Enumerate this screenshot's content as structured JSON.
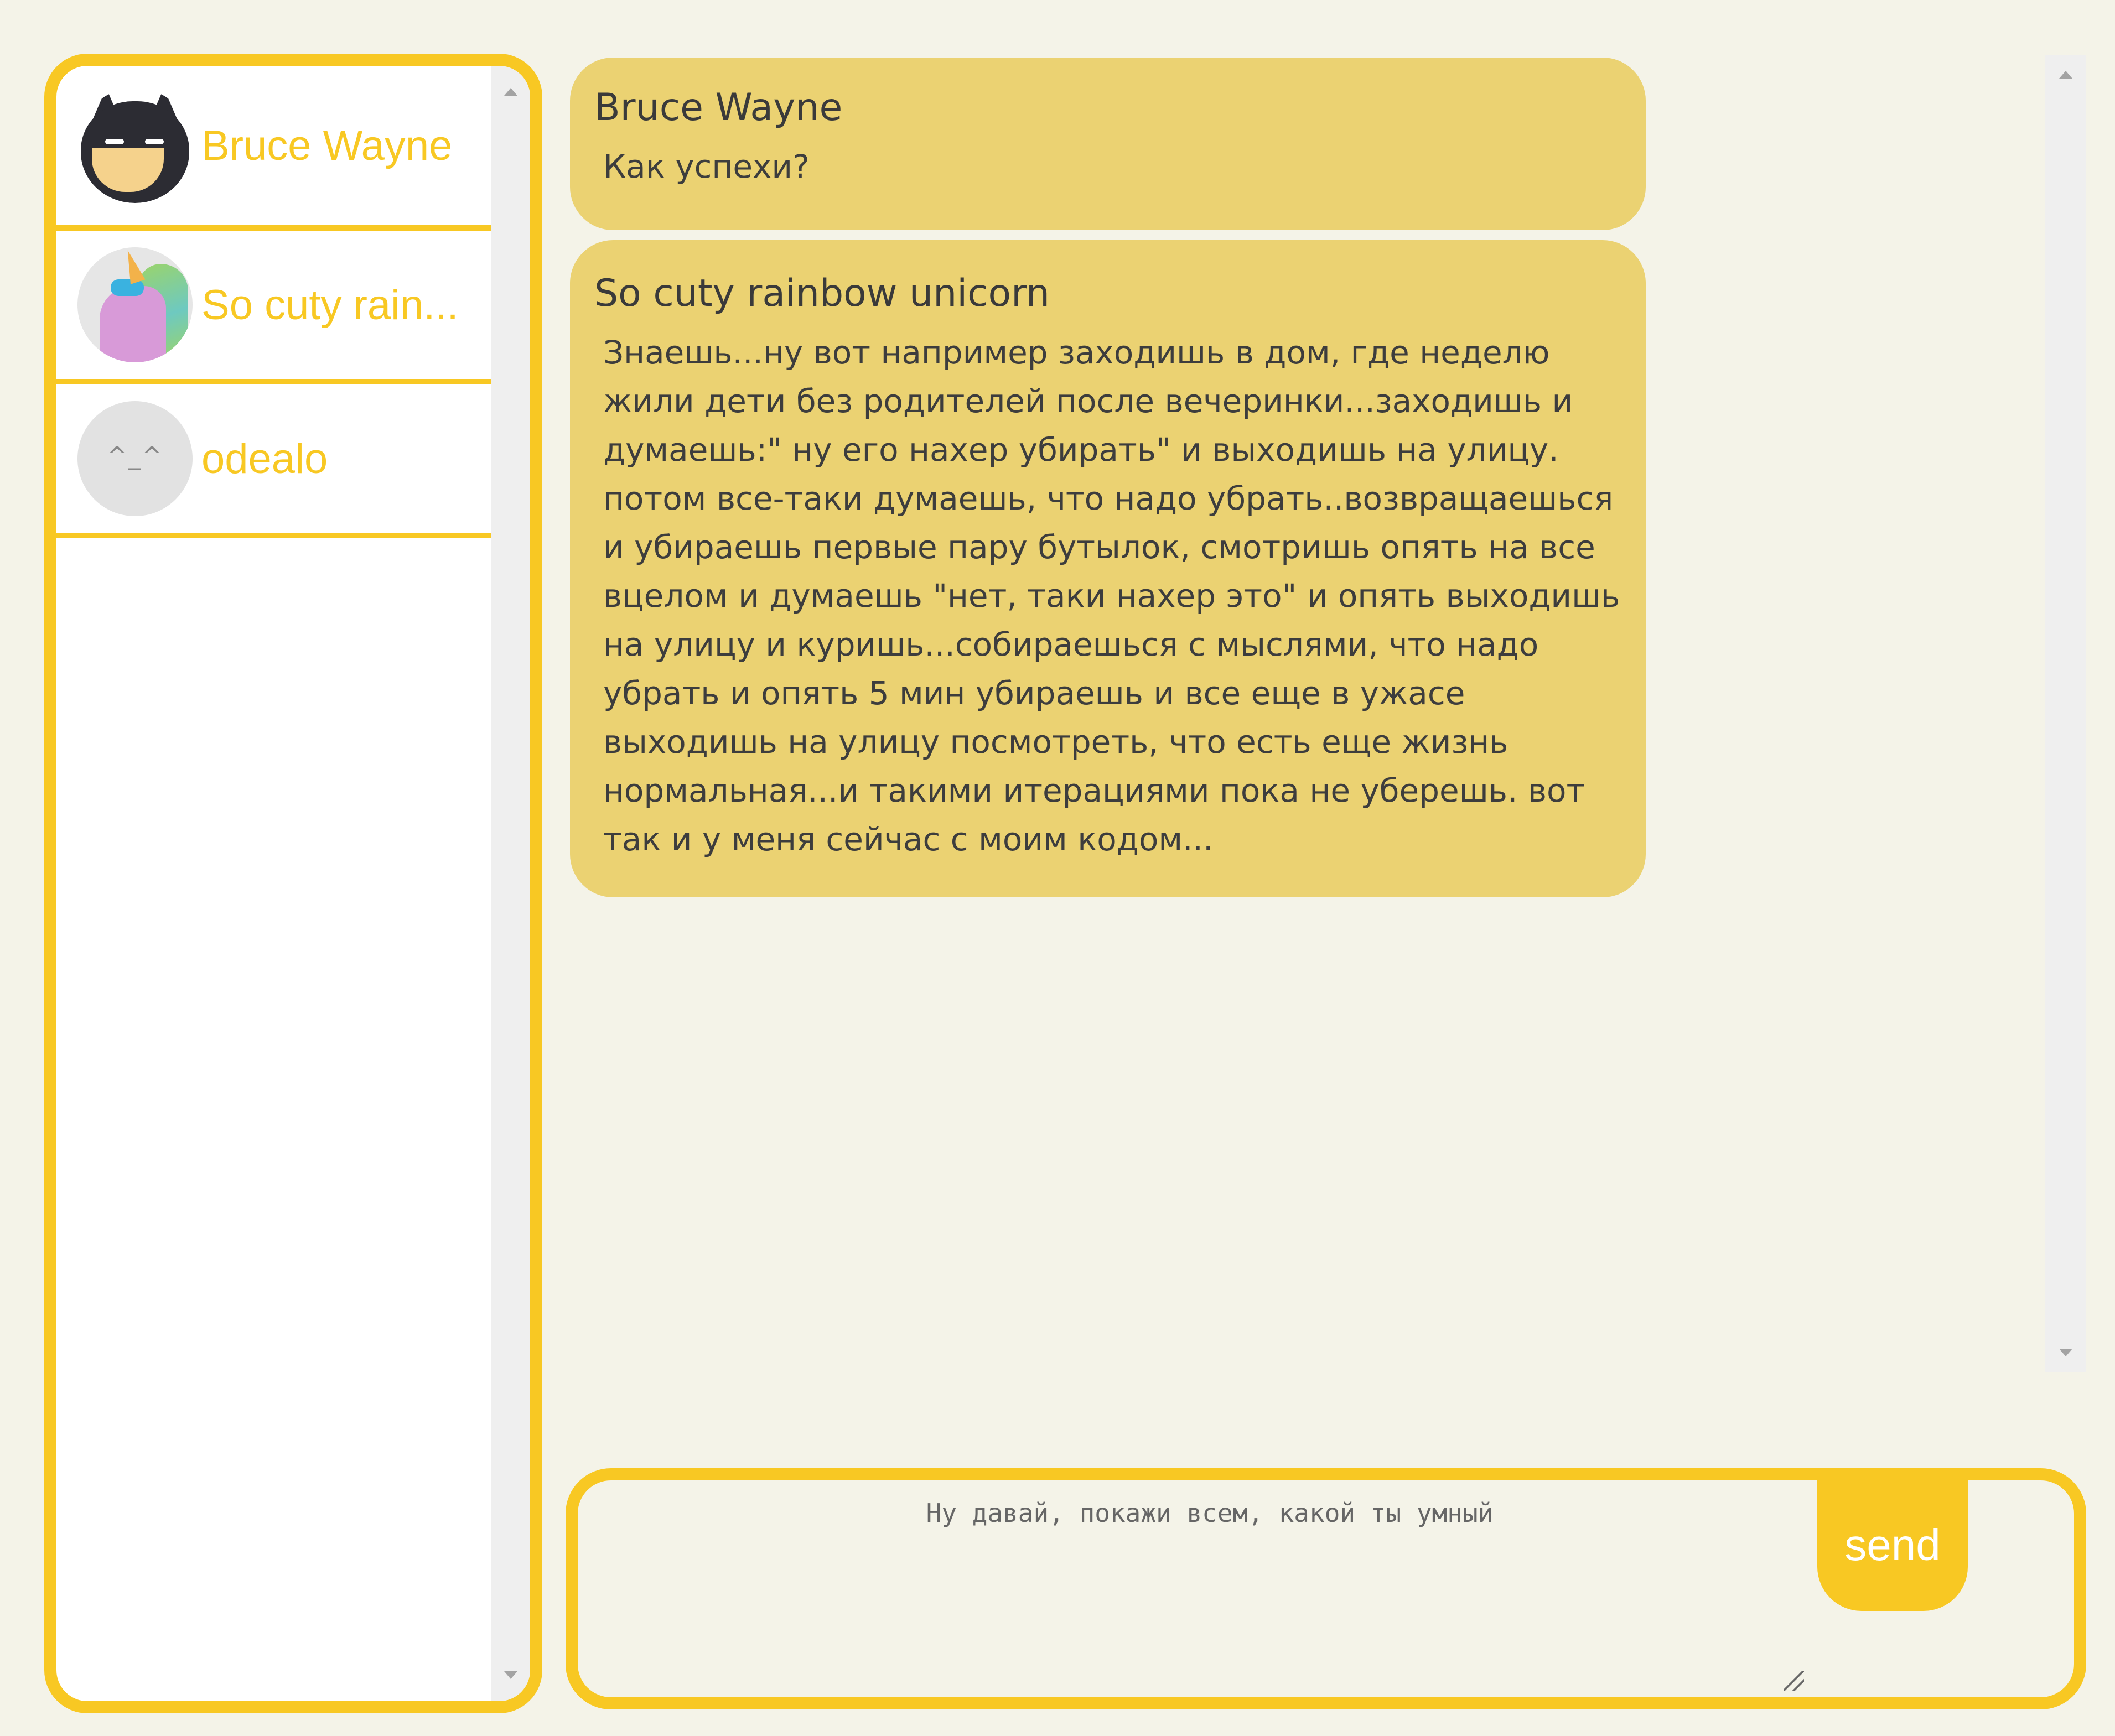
{
  "contacts": [
    {
      "name": "Bruce Wayne",
      "avatar_icon": "batman-avatar-icon"
    },
    {
      "name": "So cuty rain...",
      "avatar_icon": "unicorn-avatar-icon"
    },
    {
      "name": "odealo",
      "avatar_icon": "default-face-avatar-icon",
      "avatar_face": "^_^"
    }
  ],
  "messages": [
    {
      "author": "Bruce Wayne",
      "text": "Как успехи?"
    },
    {
      "author": "So cuty rainbow unicorn",
      "text": "Знаешь...ну вот например заходишь в дом, где неделю жили дети без родителей после вечеринки...заходишь и думаешь:\" ну его нахер убирать\" и выходишь на улицу. потом все-таки думаешь, что надо убрать..возвращаешься и убираешь первые пару бутылок, смотришь опять на все вцелом и думаешь \"нет, таки нахер это\" и опять выходишь на улицу и куришь...собираешься с мыслями, что надо убрать и опять 5 мин убираешь и все еще в ужасе выходишь на улицу посмотреть, что есть еще жизнь нормальная...и такими итерациями пока не уберешь. вот так и у меня сейчас с моим кодом..."
    }
  ],
  "compose": {
    "placeholder": "Ну давай, покажи всем, какой ты умный",
    "value": "",
    "send_label": "send"
  },
  "colors": {
    "accent": "#f8c823",
    "bubble": "#ebd272",
    "background": "#f4f3e8"
  }
}
